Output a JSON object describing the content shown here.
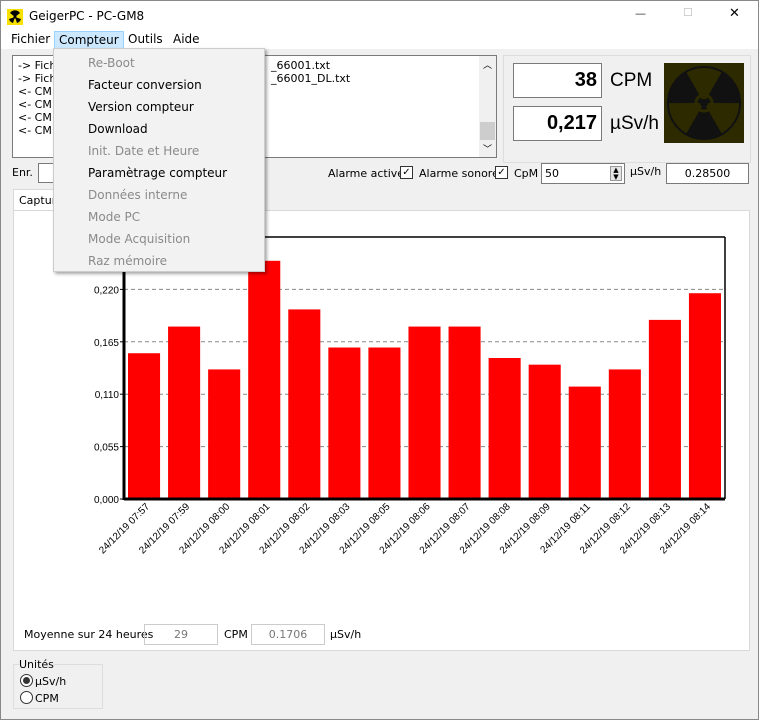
{
  "window": {
    "title": "GeigerPC  - PC-GM8",
    "minimize": "—",
    "maximize": "☐",
    "close": "✕"
  },
  "menubar": [
    "Fichier",
    "Compteur",
    "Outils",
    "Aide"
  ],
  "compteur_menu": [
    {
      "label": "Re-Boot",
      "enabled": false
    },
    {
      "label": "Facteur conversion",
      "enabled": true
    },
    {
      "label": "Version compteur",
      "enabled": true
    },
    {
      "label": "Download",
      "enabled": true
    },
    {
      "label": "Init. Date et Heure",
      "enabled": false
    },
    {
      "label": "Paramètrage compteur",
      "enabled": true
    },
    {
      "label": "Données interne",
      "enabled": false
    },
    {
      "label": "Mode PC",
      "enabled": false
    },
    {
      "label": "Mode Acquisition",
      "enabled": false
    },
    {
      "label": "Raz mémoire",
      "enabled": false
    }
  ],
  "log": {
    "left": [
      "-> Fichi",
      "-> Fichi",
      "<- CM=",
      "<- CM=",
      "<- CM=",
      "<- CM="
    ],
    "right": [
      "_66001.txt",
      "_66001_DL.txt"
    ]
  },
  "readout": {
    "cpm_value": "38",
    "cpm_unit": "CPM",
    "dose_value": "0,217",
    "dose_unit": "µSv/h",
    "icon": "radiation-icon"
  },
  "controls": {
    "enr_label": "Enr.",
    "alarm_active": "Alarme active",
    "alarm_active_checked": true,
    "alarm_sound": "Alarme sonore",
    "alarm_sound_checked": true,
    "cpm_label": "CpM",
    "cpm_threshold": "50",
    "usvh_label": "µSv/h",
    "usvh_threshold": "0.28500"
  },
  "tab": {
    "label": "Captur"
  },
  "average": {
    "label": "Moyenne sur 24 heures",
    "cpm": "29",
    "cpm_unit": "CPM",
    "dose": "0.1706",
    "dose_unit": "µSv/h"
  },
  "units": {
    "title": "Unités",
    "options": [
      "µSv/h",
      "CPM"
    ],
    "selected": "µSv/h"
  },
  "chart_data": {
    "type": "bar",
    "categories": [
      "24/12/19 07:57",
      "24/12/19 07:59",
      "24/12/19 08:00",
      "24/12/19 08:01",
      "24/12/19 08:02",
      "24/12/19 08:03",
      "24/12/19 08:05",
      "24/12/19 08:06",
      "24/12/19 08:07",
      "24/12/19 08:08",
      "24/12/19 08:09",
      "24/12/19 08:11",
      "24/12/19 08:12",
      "24/12/19 08:13",
      "24/12/19 08:14"
    ],
    "values": [
      0.153,
      0.181,
      0.136,
      0.25,
      0.199,
      0.159,
      0.159,
      0.181,
      0.181,
      0.148,
      0.141,
      0.118,
      0.136,
      0.188,
      0.216
    ],
    "yticks": [
      "0,000",
      "0,055",
      "0,110",
      "0,165",
      "0,220"
    ],
    "ylim": [
      0,
      0.275
    ],
    "grid": true,
    "bar_color": "#ff0000"
  }
}
